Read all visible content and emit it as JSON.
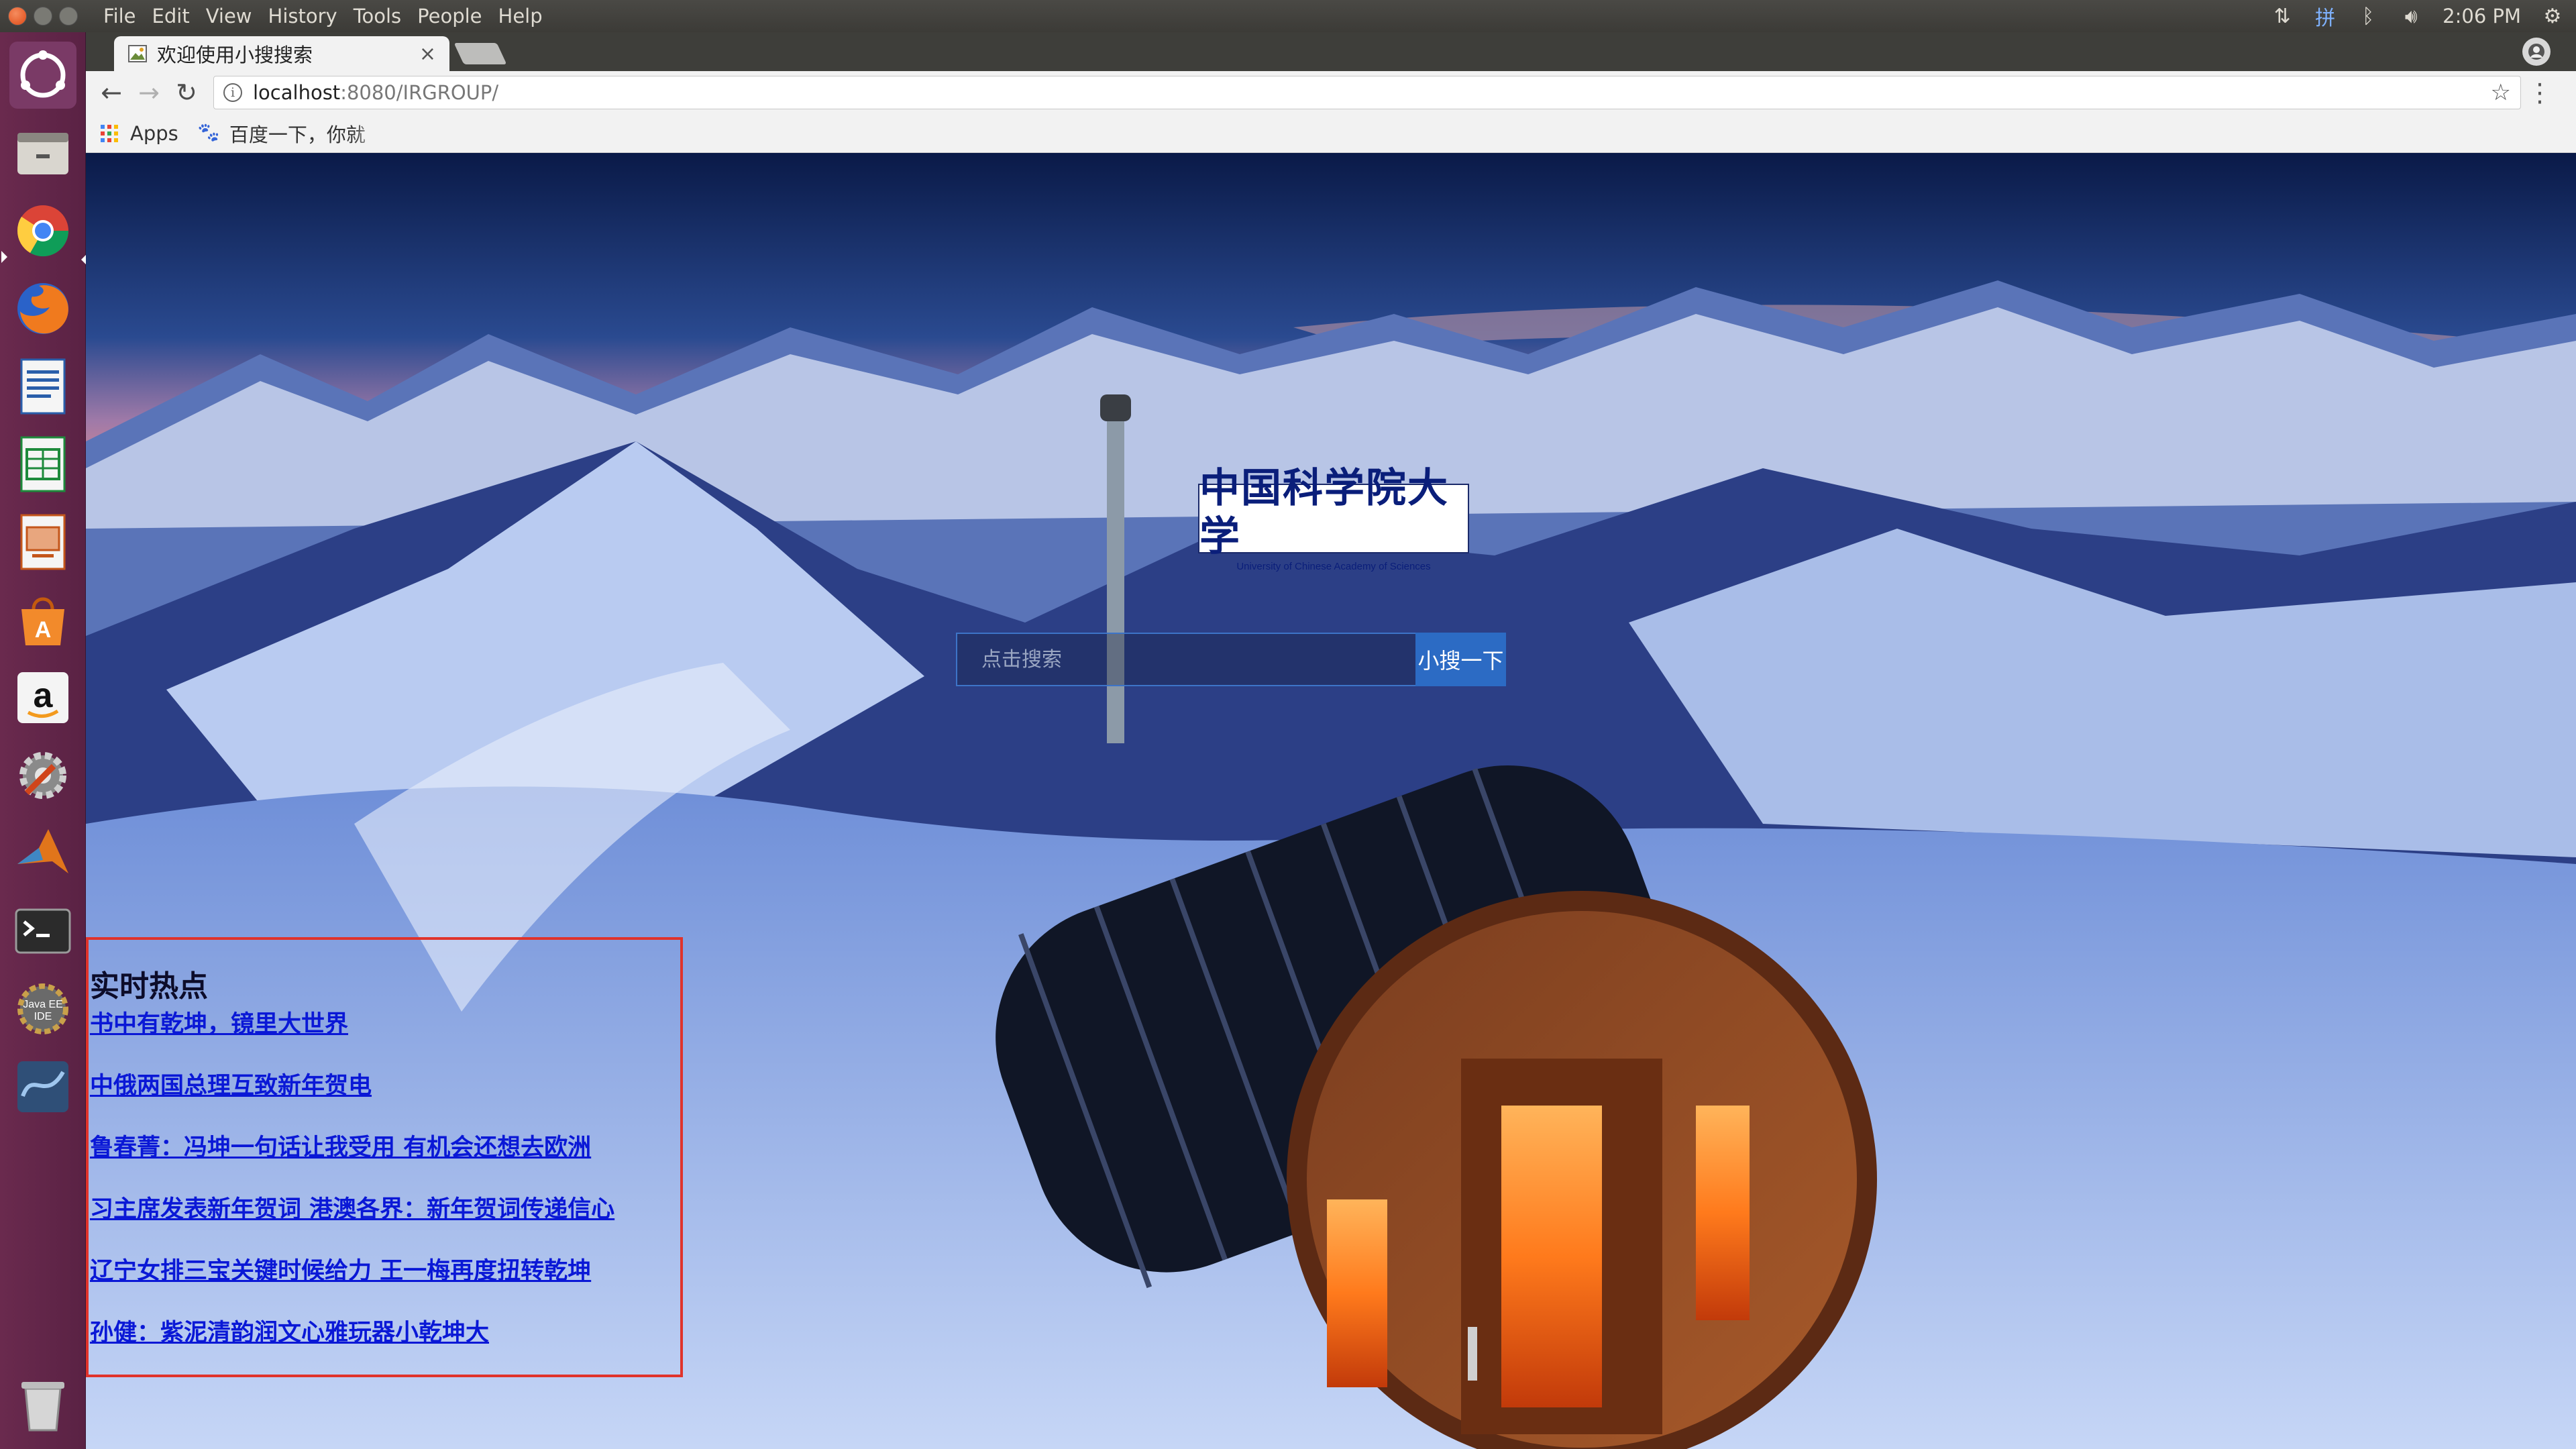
{
  "system": {
    "menu": [
      "File",
      "Edit",
      "View",
      "History",
      "Tools",
      "People",
      "Help"
    ],
    "clock": "2:06 PM"
  },
  "browser": {
    "tab_title": "欢迎使用小搜搜索",
    "tab_close": "×",
    "url_host": "localhost",
    "url_rest": ":8080/IRGROUP/",
    "bookmarks": {
      "apps": "Apps",
      "baidu": "百度一下，你就"
    }
  },
  "page": {
    "logo_cn": "中国科学院大学",
    "logo_en": "University of Chinese Academy of Sciences",
    "search": {
      "placeholder": "点击搜索",
      "value": "",
      "button": "小搜一下"
    },
    "hot": {
      "title": "实时热点",
      "items": [
        "书中有乾坤，镜里大世界",
        "中俄两国总理互致新年贺电",
        "鲁春菁：冯坤一句话让我受用 有机会还想去欧洲",
        "习主席发表新年贺词 港澳各界：新年贺词传递信心",
        "辽宁女排三宝关键时候给力 王一梅再度扭转乾坤",
        "孙健：紫泥清韵润文心雅玩器小乾坤大"
      ]
    }
  },
  "colors": {
    "launcher": "#5e2750",
    "panel": "#3c3b37",
    "search_button": "#2c6bc4",
    "hot_border": "#e0332b",
    "hot_link": "#0a18d6"
  }
}
